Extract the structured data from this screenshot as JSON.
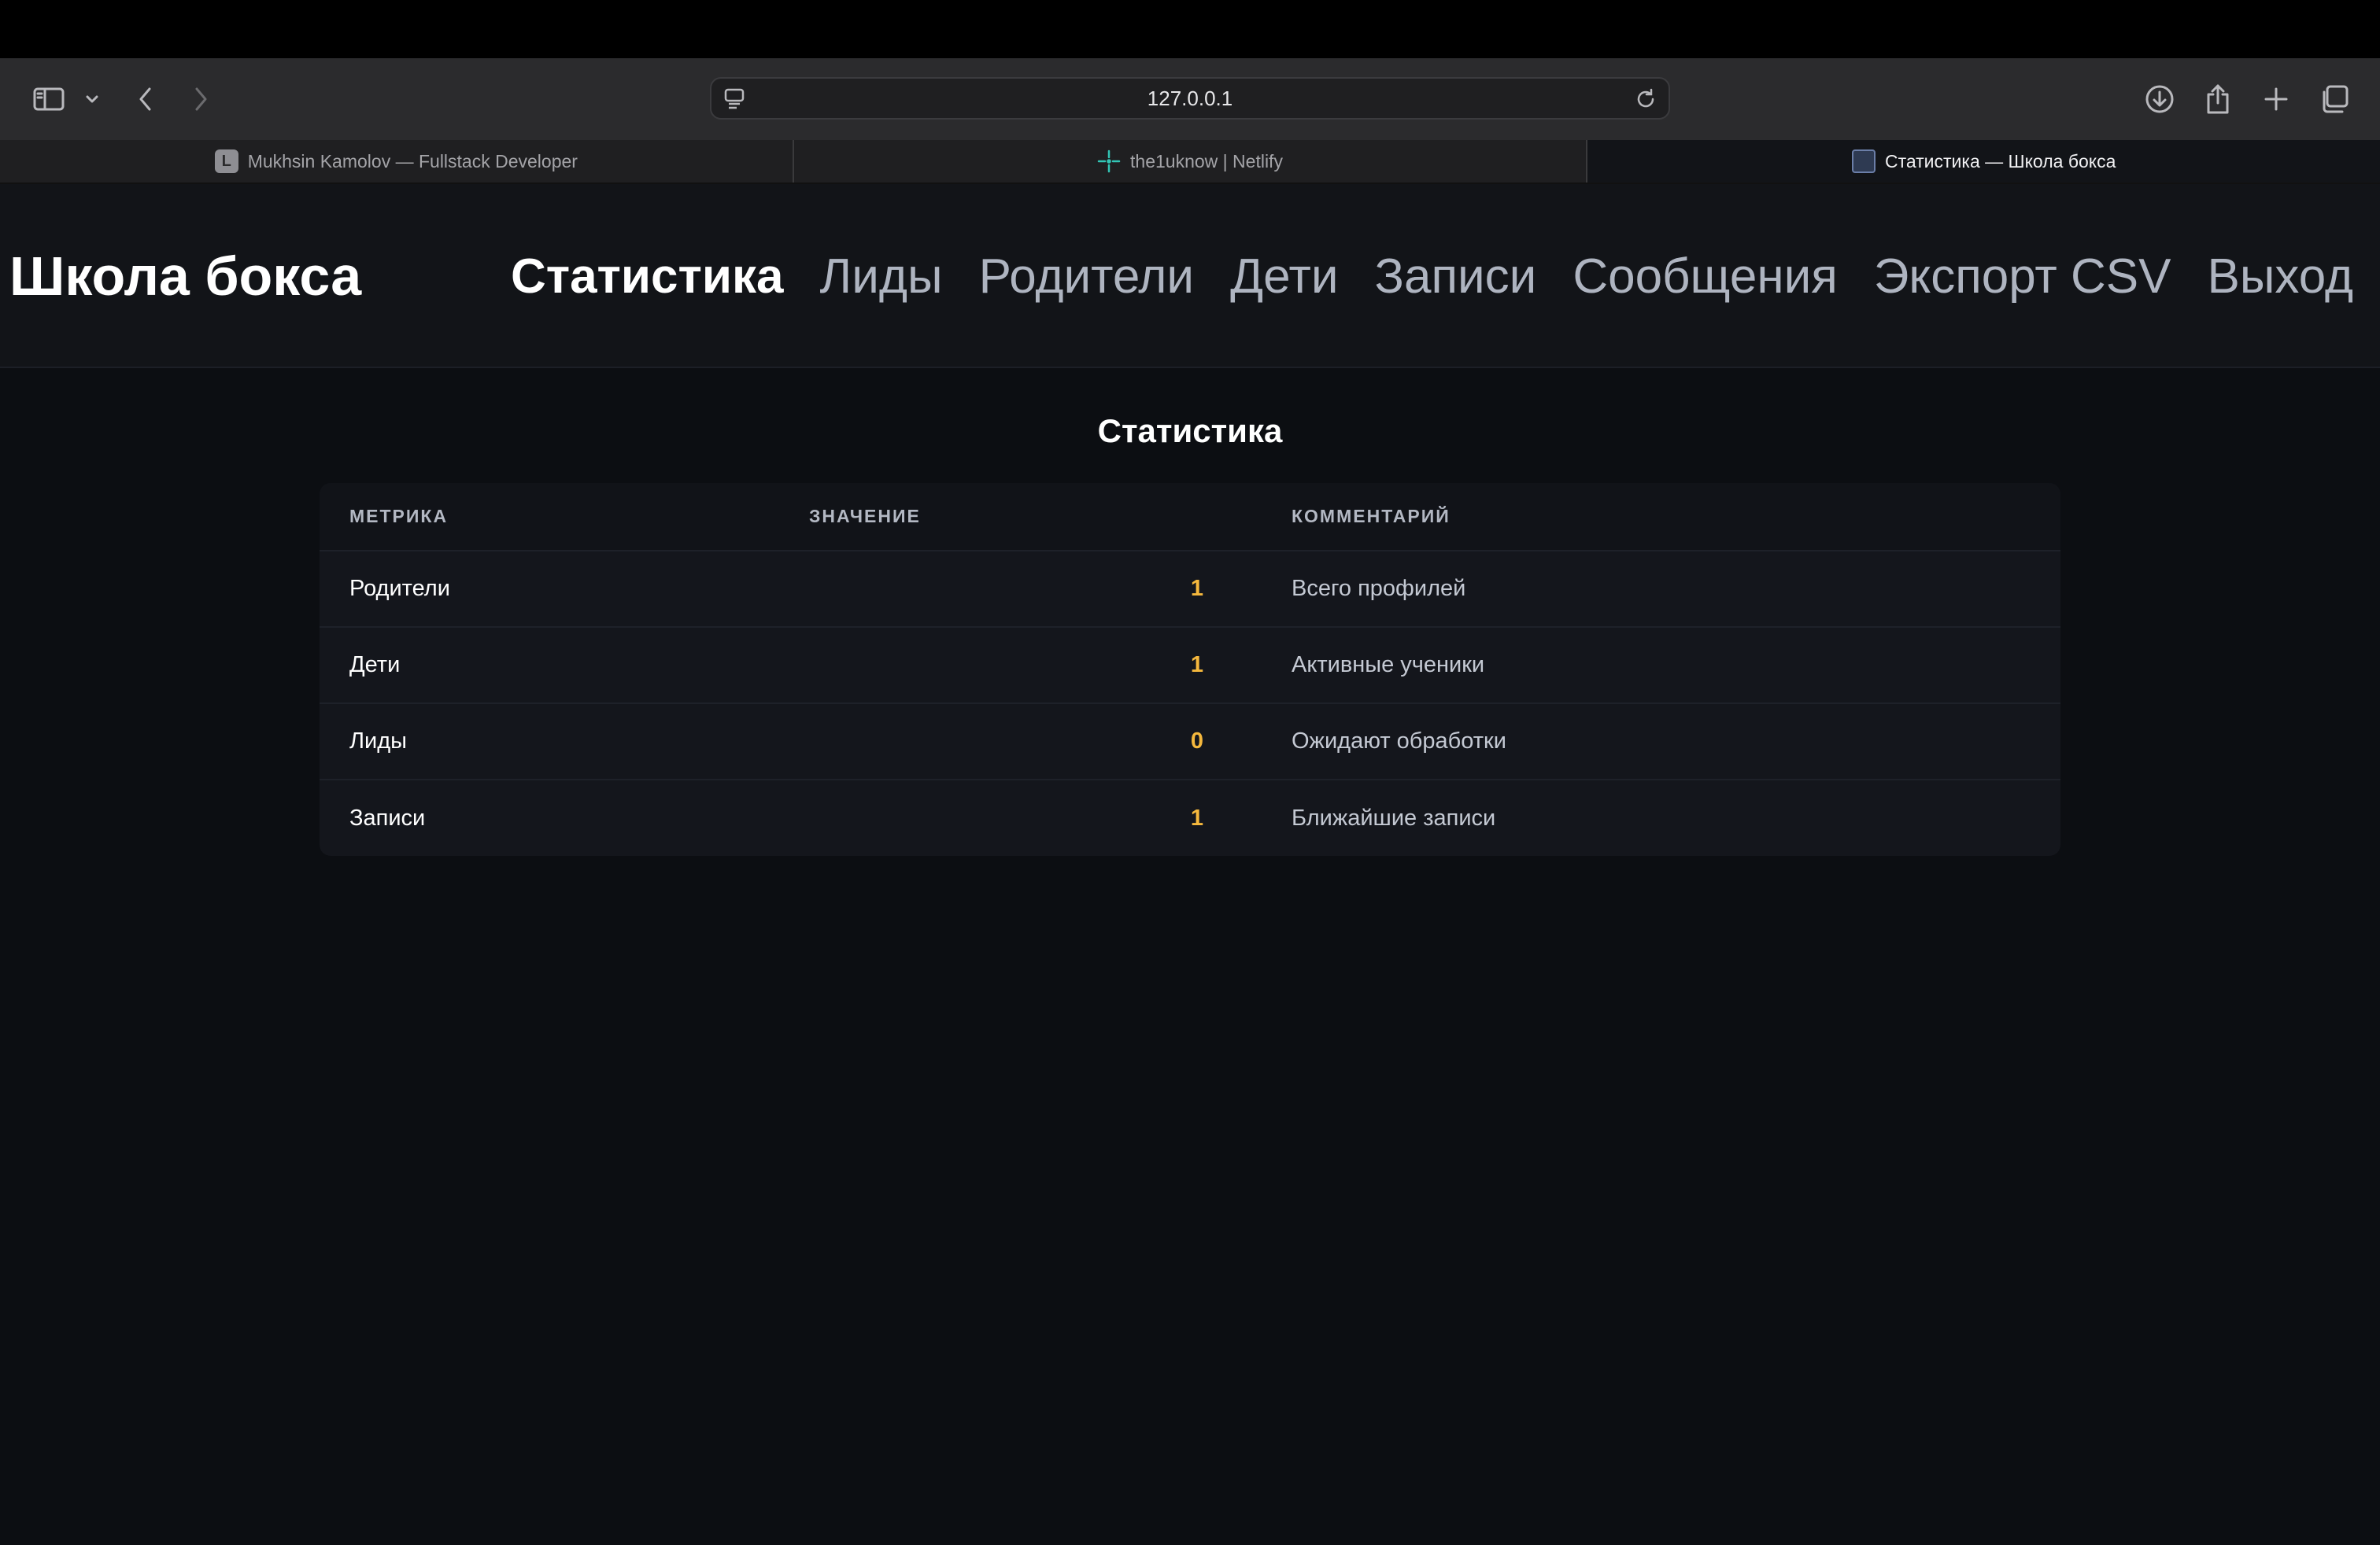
{
  "browser": {
    "url": "127.0.0.1",
    "tabs": [
      {
        "label": "Mukhsin Kamolov — Fullstack Developer",
        "favicon": "L"
      },
      {
        "label": "the1uknow | Netlify",
        "favicon": "netlify-icon"
      },
      {
        "label": "Статистика — Школа бокса",
        "favicon": "page-icon"
      }
    ]
  },
  "header": {
    "brand": "Школа бокса",
    "nav": [
      "Статистика",
      "Лиды",
      "Родители",
      "Дети",
      "Записи",
      "Сообщения",
      "Экспорт CSV",
      "Выход"
    ]
  },
  "main": {
    "title": "Статистика",
    "table": {
      "columns": [
        "МЕТРИКА",
        "ЗНАЧЕНИЕ",
        "КОММЕНТАРИЙ"
      ],
      "rows": [
        {
          "metric": "Родители",
          "value": "1",
          "comment": "Всего профилей"
        },
        {
          "metric": "Дети",
          "value": "1",
          "comment": "Активные ученики"
        },
        {
          "metric": "Лиды",
          "value": "0",
          "comment": "Ожидают обработки"
        },
        {
          "metric": "Записи",
          "value": "1",
          "comment": "Ближайшие записи"
        }
      ]
    }
  },
  "colors": {
    "accent_value": "#f5b83d",
    "background": "#0c0e12",
    "header_bg": "#121418"
  }
}
